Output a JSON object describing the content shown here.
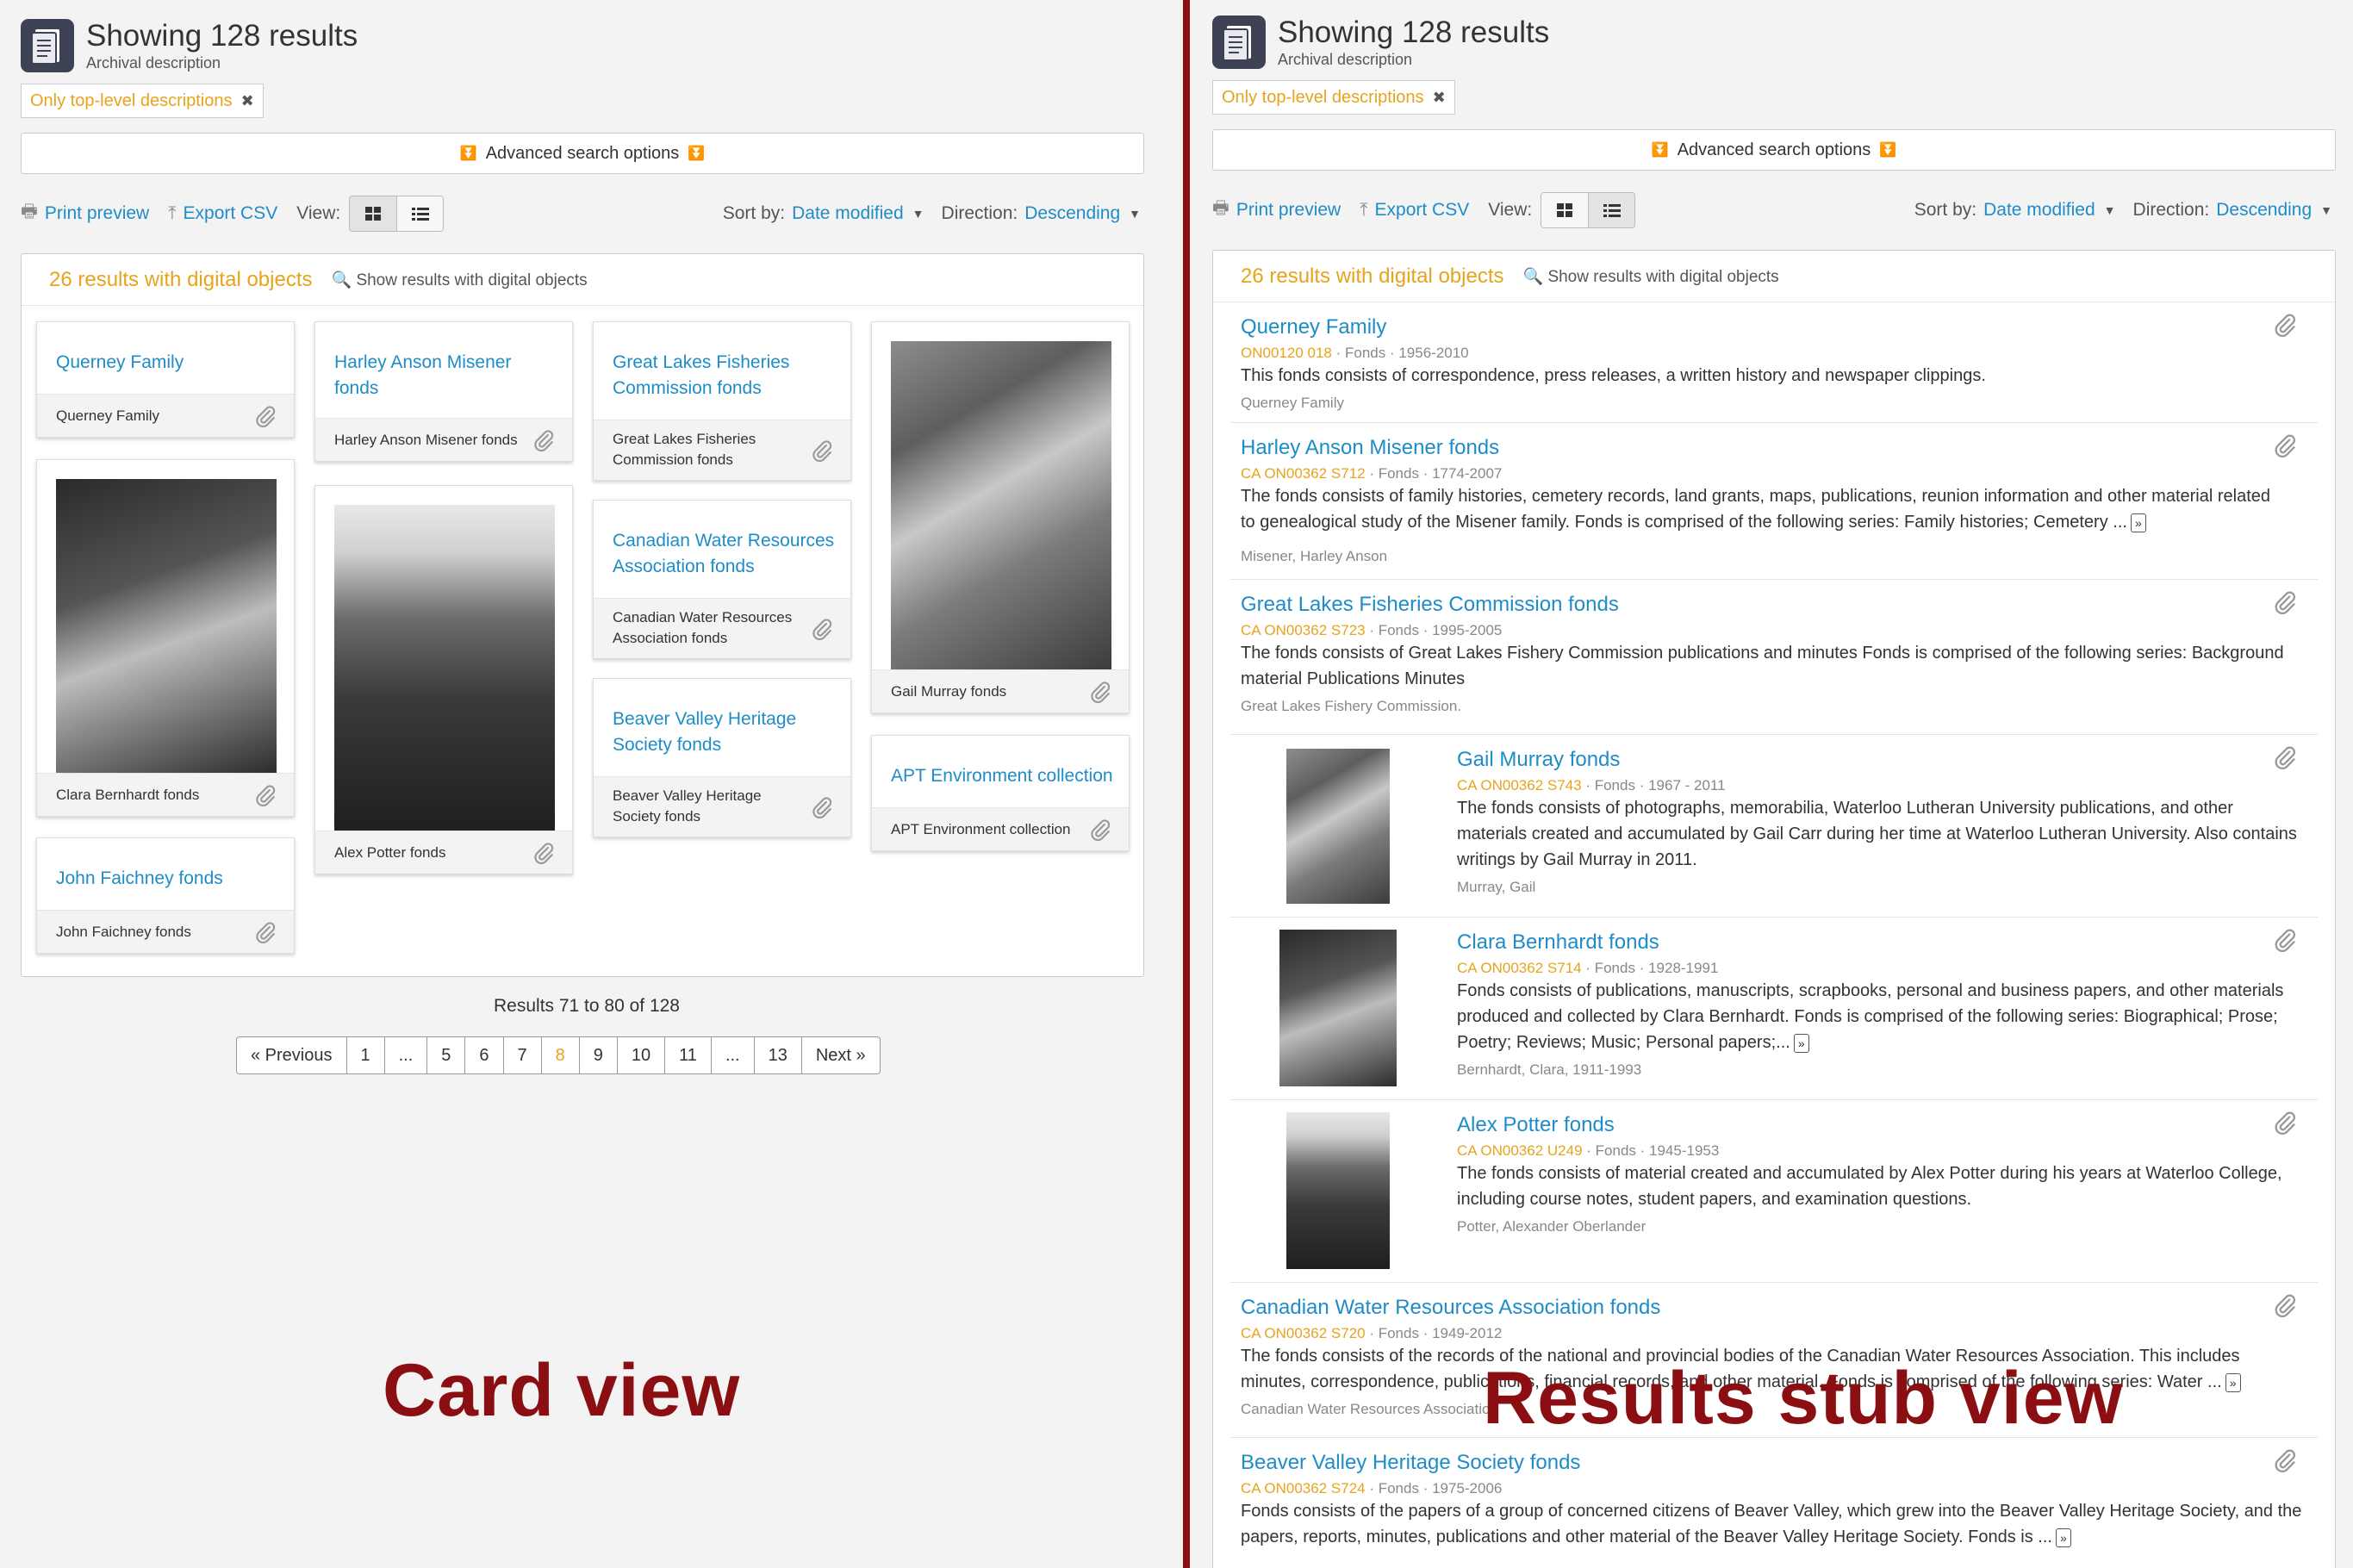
{
  "left": {
    "title": "Showing 128 results",
    "subtitle": "Archival description",
    "filter_tag": "Only top-level descriptions",
    "advanced_search": "Advanced search options",
    "print_preview": "Print preview",
    "export_csv": "Export CSV",
    "view_label": "View:",
    "sort_label": "Sort by:",
    "sort_value": "Date modified",
    "direction_label": "Direction:",
    "direction_value": "Descending",
    "digital_count": "26 results with digital objects",
    "show_digital": "Show results with digital objects",
    "cards": [
      {
        "title": "Querney Family",
        "footer": "Querney Family"
      },
      {
        "title": "Harley Anson Misener fonds",
        "footer": "Harley Anson Misener fonds"
      },
      {
        "title": "Great Lakes Fisheries Commission fonds",
        "footer": "Great Lakes Fisheries Commission fonds"
      },
      {
        "title": "",
        "footer": "Gail Murray fonds"
      },
      {
        "title": "",
        "footer": "Clara Bernhardt fonds"
      },
      {
        "title": "",
        "footer": "Alex Potter fonds"
      },
      {
        "title": "Canadian Water Resources Association fonds",
        "footer": "Canadian Water Resources Association fonds"
      },
      {
        "title": "Beaver Valley Heritage Society fonds",
        "footer": "Beaver Valley Heritage Society fonds"
      },
      {
        "title": "APT Environment collection",
        "footer": "APT Environment collection"
      },
      {
        "title": "John Faichney fonds",
        "footer": "John Faichney fonds"
      }
    ],
    "results_range": "Results 71 to 80 of 128",
    "pager": [
      "« Previous",
      "1",
      "...",
      "5",
      "6",
      "7",
      "8",
      "9",
      "10",
      "11",
      "...",
      "13",
      "Next »"
    ],
    "pager_active": "8",
    "big_label": "Card view"
  },
  "right": {
    "title": "Showing 128 results",
    "subtitle": "Archival description",
    "filter_tag": "Only top-level descriptions",
    "advanced_search": "Advanced search options",
    "print_preview": "Print preview",
    "export_csv": "Export CSV",
    "view_label": "View:",
    "sort_label": "Sort by:",
    "sort_value": "Date modified",
    "direction_label": "Direction:",
    "direction_value": "Descending",
    "digital_count": "26 results with digital objects",
    "show_digital": "Show results with digital objects",
    "stubs": [
      {
        "title": "Querney Family",
        "ref": "ON00120 018",
        "level": "Fonds",
        "dates": "1956-2010",
        "desc1": "This fonds consists of correspondence, press releases, a written history and newspaper clippings.",
        "desc2": "",
        "desc3": "",
        "creator": "Querney Family"
      },
      {
        "title": "Harley Anson Misener fonds",
        "ref": "CA ON00362 S712",
        "level": "Fonds",
        "dates": "1774-2007",
        "desc1": "The fonds consists of family histories, cemetery records, land grants, maps, publications, reunion information and other material related",
        "desc2": "to genealogical study of the Misener family. Fonds is comprised of the following series: Family histories; Cemetery ...",
        "desc3": "",
        "creator": "Misener, Harley Anson"
      },
      {
        "title": "Great Lakes Fisheries Commission fonds",
        "ref": "CA ON00362 S723",
        "level": "Fonds",
        "dates": "1995-2005",
        "desc1": "The fonds consists of Great Lakes Fishery Commission publications and minutes Fonds is comprised of the following series: Background",
        "desc2": "material Publications Minutes",
        "desc3": "",
        "creator": "Great Lakes Fishery Commission."
      },
      {
        "title": "Gail Murray fonds",
        "ref": "CA ON00362 S743",
        "level": "Fonds",
        "dates": "1967 - 2011",
        "desc1": "The fonds consists of photographs, memorabilia, Waterloo Lutheran University publications, and other",
        "desc2": "materials created and accumulated by Gail Carr during her time at Waterloo Lutheran University. Also contains",
        "desc3": "writings by Gail Murray in 2011.",
        "creator": "Murray, Gail"
      },
      {
        "title": "Clara Bernhardt fonds",
        "ref": "CA ON00362 S714",
        "level": "Fonds",
        "dates": "1928-1991",
        "desc1": "Fonds consists of publications, manuscripts, scrapbooks, personal and business papers, and other materials",
        "desc2": "produced and collected by Clara Bernhardt. Fonds is comprised of the following series: Biographical; Prose;",
        "desc3": "Poetry; Reviews; Music; Personal papers;...",
        "creator": "Bernhardt, Clara, 1911-1993"
      },
      {
        "title": "Alex Potter fonds",
        "ref": "CA ON00362 U249",
        "level": "Fonds",
        "dates": "1945-1953",
        "desc1": "The fonds consists of material created and accumulated by Alex Potter during his years at Waterloo College,",
        "desc2": "including course notes, student papers, and examination questions.",
        "desc3": "",
        "creator": "Potter, Alexander Oberlander"
      },
      {
        "title": "Canadian Water Resources Association fonds",
        "ref": "CA ON00362 S720",
        "level": "Fonds",
        "dates": "1949-2012",
        "desc1": "The fonds consists of the records of the national and provincial bodies of the Canadian Water Resources Association. This includes",
        "desc2": "minutes, correspondence, publications, financial records, and other material. Fonds is comprised of the following series: Water ...",
        "desc3": "",
        "creator": "Canadian Water Resources Association"
      },
      {
        "title": "Beaver Valley Heritage Society fonds",
        "ref": "CA ON00362 S724",
        "level": "Fonds",
        "dates": "1975-2006",
        "desc1": "Fonds consists of the papers of a group of concerned citizens of Beaver Valley, which grew into the Beaver Valley Heritage Society, and the",
        "desc2": "papers, reports, minutes, publications and other material of the Beaver Valley Heritage Society. Fonds is ...",
        "desc3": "",
        "creator": ""
      }
    ],
    "more_glyph": "»",
    "big_label": "Results stub view"
  },
  "colors": {
    "accent_link": "#1e8cc8",
    "accent_orange": "#e8a31c",
    "label_red": "#8b0e12",
    "header_icon": "#3d4255"
  },
  "icons": [
    "document-icon",
    "print-icon",
    "export-icon",
    "grid-view-icon",
    "list-view-icon",
    "search-icon",
    "paperclip-icon",
    "double-chevron-down-icon",
    "caret-down-icon",
    "close-icon"
  ]
}
